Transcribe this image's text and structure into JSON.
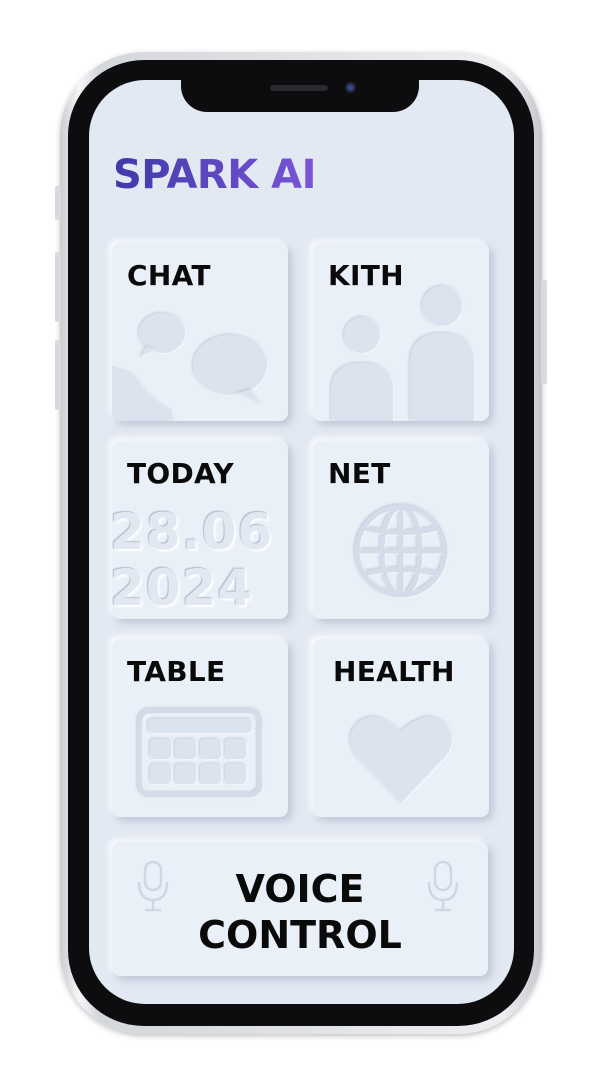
{
  "app": {
    "title": "SPARK AI"
  },
  "tiles": {
    "chat": {
      "label": "CHAT",
      "icon": "chat-bubbles-icon"
    },
    "kith": {
      "label": "KITH",
      "icon": "people-icon"
    },
    "today": {
      "label": "TODAY",
      "date_line1": "28.06",
      "date_line2": "2024"
    },
    "net": {
      "label": "NET",
      "icon": "globe-icon"
    },
    "table": {
      "label": "TABLE",
      "icon": "calendar-grid-icon"
    },
    "health": {
      "label": "HEALTH",
      "icon": "heart-icon"
    }
  },
  "voice": {
    "line1": "VOICE",
    "line2": "CONTROL",
    "icon": "microphone-icon"
  },
  "colors": {
    "title_gradient_start": "#3f3aa8",
    "title_gradient_end": "#7a55d6",
    "screen_bg": "#e3e9f3",
    "tile_bg": "#eaf0f8"
  }
}
